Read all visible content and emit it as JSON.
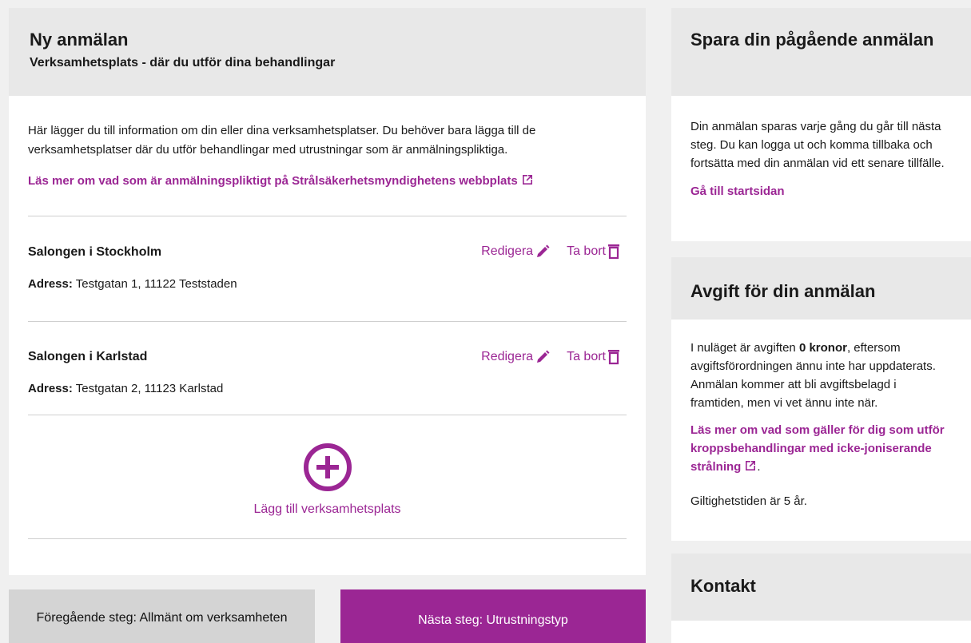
{
  "main": {
    "title": "Ny anmälan",
    "subtitle": "Verksamhetsplats - där du utför dina behandlingar",
    "intro": "Här lägger du till information om din eller dina verksamhetsplatser. Du behöver bara lägga till de verksamhetsplatser där du utför behandlingar med utrustningar som är anmälningspliktiga.",
    "read_more": "Läs mer om vad som är anmälningspliktigt på Strålsäkerhetsmyndighetens webbplats",
    "places": [
      {
        "name": "Salongen i Stockholm",
        "address_label": "Adress:",
        "address": "Testgatan 1, 11122 Teststaden"
      },
      {
        "name": "Salongen i Karlstad",
        "address_label": "Adress:",
        "address": "Testgatan 2, 11123 Karlstad"
      }
    ],
    "edit_label": "Redigera",
    "remove_label": "Ta bort",
    "add_label": "Lägg till verksamhetsplats"
  },
  "nav": {
    "prev": "Föregående steg: Allmänt om verksamheten",
    "next": "Nästa steg: Utrustningstyp"
  },
  "sidebar": {
    "save": {
      "title": "Spara din pågående anmälan",
      "text": "Din anmälan sparas varje gång du går till nästa steg. Du kan logga ut och komma tillbaka och fortsätta med din anmälan vid ett senare tillfälle.",
      "link": "Gå till startsidan"
    },
    "fee": {
      "title": "Avgift för din anmälan",
      "text_before": "I nuläget är avgiften ",
      "amount": "0 kronor",
      "text_after": ", eftersom avgiftsförordningen ännu inte har uppdaterats. Anmälan kommer att bli avgiftsbelagd i framtiden, men vi vet ännu inte när.",
      "link": "Läs mer om vad som gäller för dig som utför kroppsbehandlingar med icke-joniserande strålning",
      "link_suffix": ".",
      "validity": "Giltighetstiden är 5 år."
    },
    "contact": {
      "title": "Kontakt"
    }
  },
  "colors": {
    "accent": "#9b2694",
    "panel": "#e8e8e8",
    "background": "#f0f0f0"
  }
}
